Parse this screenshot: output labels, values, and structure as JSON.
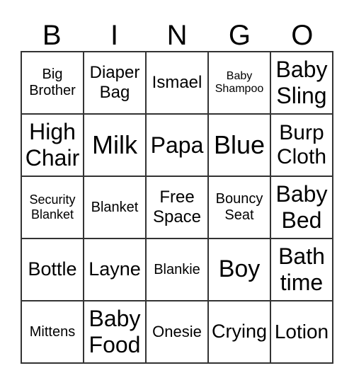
{
  "header": [
    "B",
    "I",
    "N",
    "G",
    "O"
  ],
  "cells": [
    "Big\nBrother",
    "Diaper\nBag",
    "Ismael",
    "Baby\nShampoo",
    "Baby\nSling",
    "High\nChair",
    "Milk",
    "Papa",
    "Blue",
    "Burp\nCloth",
    "Security\nBlanket",
    "Blanket",
    "Free\nSpace",
    "Bouncy\nSeat",
    "Baby\nBed",
    "Bottle",
    "Layne",
    "Blankie",
    "Boy",
    "Bath\ntime",
    "Mittens",
    "Baby\nFood",
    "Onesie",
    "Crying",
    "Lotion"
  ]
}
